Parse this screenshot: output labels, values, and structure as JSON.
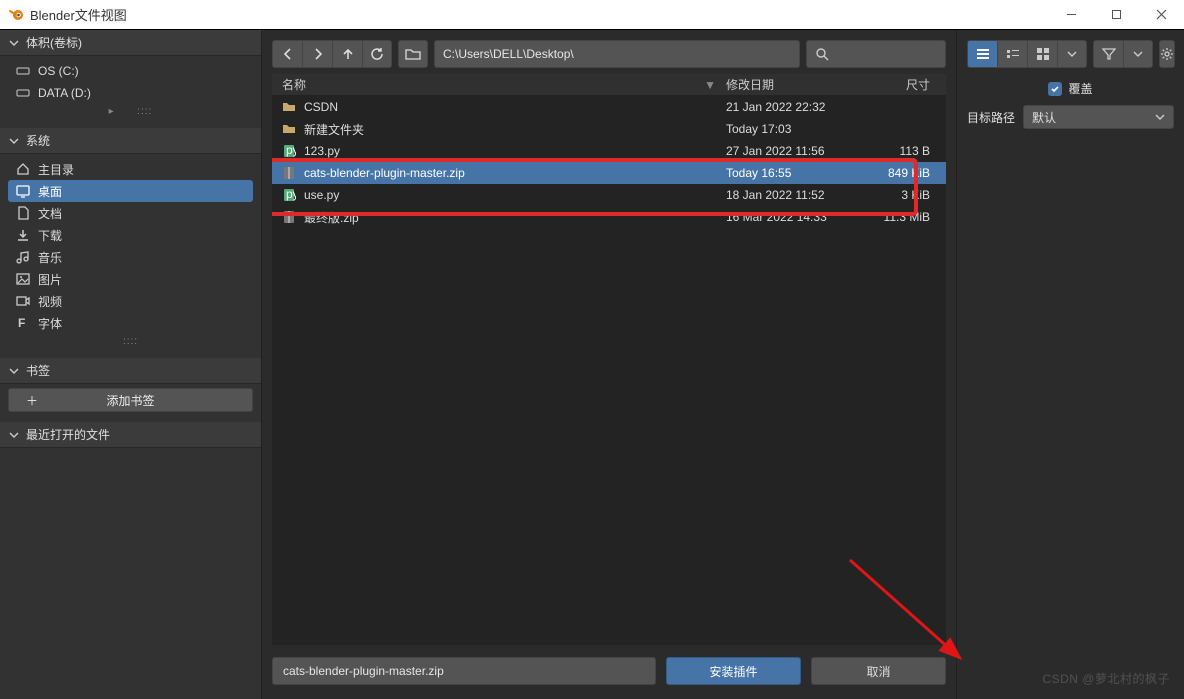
{
  "window": {
    "title": "Blender文件视图"
  },
  "sidebar": {
    "volumes": {
      "header": "体积(卷标)",
      "items": [
        "OS (C:)",
        "DATA (D:)"
      ]
    },
    "system": {
      "header": "系统",
      "items": [
        "主目录",
        "桌面",
        "文档",
        "下载",
        "音乐",
        "图片",
        "视频",
        "字体"
      ],
      "selectedIndex": 1
    },
    "bookmarks": {
      "header": "书签",
      "addLabel": "添加书签"
    },
    "recent": {
      "header": "最近打开的文件"
    }
  },
  "toolbar": {
    "path": "C:\\Users\\DELL\\Desktop\\"
  },
  "columns": {
    "name": "名称",
    "date": "修改日期",
    "size": "尺寸"
  },
  "files": [
    {
      "icon": "folder",
      "name": "CSDN",
      "date": "21 Jan 2022 22:32",
      "size": ""
    },
    {
      "icon": "folder",
      "name": "新建文件夹",
      "date": "Today 17:03",
      "size": ""
    },
    {
      "icon": "py",
      "name": "123.py",
      "date": "27 Jan 2022 11:56",
      "size": "113 B"
    },
    {
      "icon": "zip",
      "name": "cats-blender-plugin-master.zip",
      "date": "Today 16:55",
      "size": "849 KiB",
      "selected": true
    },
    {
      "icon": "py",
      "name": "use.py",
      "date": "18 Jan 2022 11:52",
      "size": "3 KiB"
    },
    {
      "icon": "zip",
      "name": "最终版.zip",
      "date": "16 Mar 2022 14:33",
      "size": "11.3 MiB"
    }
  ],
  "footer": {
    "filename": "cats-blender-plugin-master.zip",
    "install": "安装插件",
    "cancel": "取消"
  },
  "right": {
    "override": {
      "label": "覆盖",
      "checked": true
    },
    "targetPath": {
      "label": "目标路径",
      "value": "默认"
    }
  },
  "watermark": "CSDN @萝北村的枫子"
}
